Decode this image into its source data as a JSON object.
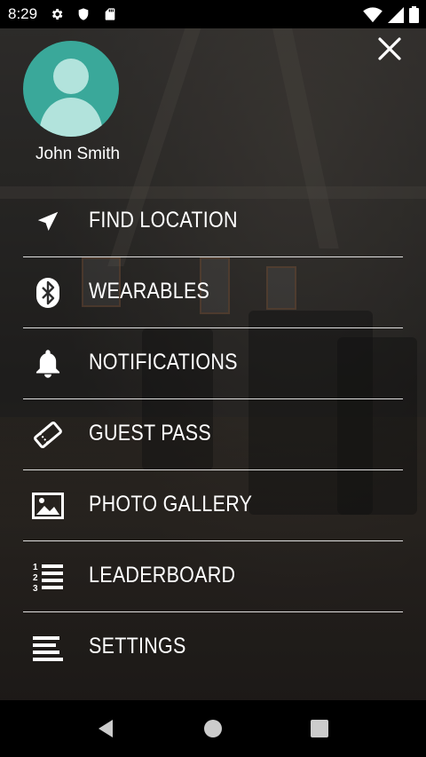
{
  "status_bar": {
    "time": "8:29"
  },
  "profile": {
    "name": "John Smith",
    "avatar_color": "#3aa89a"
  },
  "menu": {
    "items": [
      {
        "label": "FIND LOCATION",
        "icon": "navigation-arrow-icon"
      },
      {
        "label": "WEARABLES",
        "icon": "bluetooth-icon"
      },
      {
        "label": "NOTIFICATIONS",
        "icon": "bell-icon"
      },
      {
        "label": "GUEST PASS",
        "icon": "ticket-icon"
      },
      {
        "label": "PHOTO GALLERY",
        "icon": "image-icon"
      },
      {
        "label": "LEADERBOARD",
        "icon": "ranked-list-icon"
      },
      {
        "label": "SETTINGS",
        "icon": "align-left-lines-icon"
      }
    ]
  },
  "colors": {
    "text": "#ffffff",
    "accent": "#3aa89a"
  }
}
